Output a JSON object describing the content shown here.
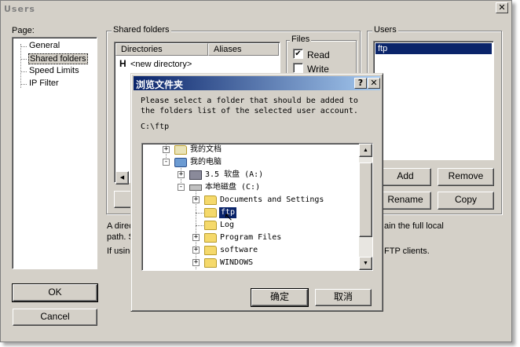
{
  "window": {
    "title": "Users",
    "close_glyph": "✕"
  },
  "page_panel": {
    "label": "Page:",
    "items": [
      {
        "label": "General",
        "selected": false
      },
      {
        "label": "Shared folders",
        "selected": true
      },
      {
        "label": "Speed Limits",
        "selected": false
      },
      {
        "label": "IP Filter",
        "selected": false
      }
    ]
  },
  "shared_folders": {
    "label": "Shared folders",
    "col_directories": "Directories",
    "col_aliases": "Aliases",
    "row_home": "H",
    "row_new": "<new directory>",
    "files_label": "Files",
    "read_label": "Read",
    "read_checked": true,
    "write_label": "Write",
    "write_checked": false,
    "desc_line1": "A direc",
    "desc_line2": "path. S",
    "desc_line3": "If using",
    "desc_right1": "ain the full local",
    "desc_right3": "FTP clients."
  },
  "users": {
    "label": "Users",
    "items": [
      "ftp"
    ],
    "add": "Add",
    "remove": "Remove",
    "rename": "Rename",
    "copy": "Copy"
  },
  "footer": {
    "ok": "OK",
    "cancel": "Cancel"
  },
  "browse_dialog": {
    "title": "浏览文件夹",
    "help_glyph": "?",
    "close_glyph": "✕",
    "prompt_line1": "Please select a folder that should be added to",
    "prompt_line2": "the folders list of the selected user account.",
    "path": "C:\\ftp",
    "tree": [
      {
        "label": "我的文档",
        "level": 1,
        "expander": "+",
        "icon": "my-documents-icon"
      },
      {
        "label": "我的电脑",
        "level": 1,
        "expander": "-",
        "icon": "my-computer-icon"
      },
      {
        "label": "3.5 软盘 (A:)",
        "level": 2,
        "expander": "+",
        "icon": "floppy-drive-icon"
      },
      {
        "label": "本地磁盘 (C:)",
        "level": 2,
        "expander": "-",
        "icon": "hard-disk-icon"
      },
      {
        "label": "Documents and Settings",
        "level": 3,
        "expander": "+",
        "icon": "folder-icon"
      },
      {
        "label": "ftp",
        "level": 3,
        "expander": "",
        "icon": "folder-icon",
        "selected": true
      },
      {
        "label": "Log",
        "level": 3,
        "expander": "",
        "icon": "folder-icon"
      },
      {
        "label": "Program Files",
        "level": 3,
        "expander": "+",
        "icon": "folder-icon"
      },
      {
        "label": "software",
        "level": 3,
        "expander": "+",
        "icon": "folder-icon"
      },
      {
        "label": "WINDOWS",
        "level": 3,
        "expander": "+",
        "icon": "folder-icon"
      }
    ],
    "ok": "确定",
    "cancel": "取消"
  }
}
